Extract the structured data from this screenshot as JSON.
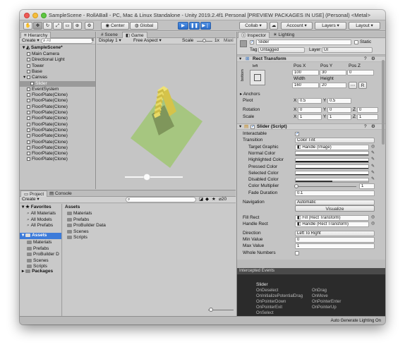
{
  "window": {
    "title": "SampleScene - RollABall - PC, Mac & Linux Standalone - Unity 2019.2.4f1 Personal [PREVIEW PACKAGES IN USE] (Personal) <Metal>"
  },
  "toolbar": {
    "pivot": "Center",
    "space": "Global",
    "collab": "Collab",
    "account": "Account",
    "layers": "Layers",
    "layout": "Layout"
  },
  "hierarchy": {
    "tab": "Hierarchy",
    "create": "Create",
    "search_placeholder": "All",
    "scene": "SampleScene*",
    "items": [
      {
        "label": "Main Camera",
        "indent": 2
      },
      {
        "label": "Directional Light",
        "indent": 2
      },
      {
        "label": "Tower",
        "indent": 2
      },
      {
        "label": "Base",
        "indent": 2
      },
      {
        "label": "Canvas",
        "indent": 2
      },
      {
        "label": "Slider",
        "indent": 3
      },
      {
        "label": "EventSystem",
        "indent": 2
      },
      {
        "label": "FloorPlate(Clone)",
        "indent": 2
      },
      {
        "label": "FloorPlate(Clone)",
        "indent": 2
      },
      {
        "label": "FloorPlate(Clone)",
        "indent": 2
      },
      {
        "label": "FloorPlate(Clone)",
        "indent": 2
      },
      {
        "label": "FloorPlate(Clone)",
        "indent": 2
      },
      {
        "label": "FloorPlate(Clone)",
        "indent": 2
      },
      {
        "label": "FloorPlate(Clone)",
        "indent": 2
      },
      {
        "label": "FloorPlate(Clone)",
        "indent": 2
      },
      {
        "label": "FloorPlate(Clone)",
        "indent": 2
      },
      {
        "label": "FloorPlate(Clone)",
        "indent": 2
      },
      {
        "label": "FloorPlate(Clone)",
        "indent": 2
      },
      {
        "label": "FloorPlate(Clone)",
        "indent": 2
      }
    ]
  },
  "scene_view": {
    "tabs": [
      "Scene",
      "Game"
    ],
    "display": "Display 1",
    "aspect": "Free Aspect",
    "scale_label": "Scale",
    "scale_value": "1x",
    "maximize": "Maxi",
    "slider_value": 0.5
  },
  "project": {
    "tabs": [
      "Project",
      "Console"
    ],
    "create": "Create",
    "count": "20",
    "favorites_label": "Favorites",
    "favorites": [
      "All Materials",
      "All Models",
      "All Prefabs"
    ],
    "assets_label": "Assets",
    "asset_folders": [
      "Materials",
      "Prefabs",
      "ProBuilder D",
      "Scenes",
      "Scripts"
    ],
    "packages_label": "Packages",
    "main_header": "Assets",
    "main_items": [
      "Materials",
      "Prefabs",
      "ProBuilder Data",
      "Scenes",
      "Scripts"
    ]
  },
  "inspector": {
    "tabs": [
      "Inspector",
      "Lighting"
    ],
    "object_name": "Slider",
    "static_label": "Static",
    "tag_label": "Tag",
    "tag_value": "Untagged",
    "layer_label": "Layer",
    "layer_value": "UI",
    "rect_transform": {
      "title": "Rect Transform",
      "anchor_h": "left",
      "anchor_v": "bottom",
      "pos_x_label": "Pos X",
      "pos_y_label": "Pos Y",
      "pos_z_label": "Pos Z",
      "pos_x": "100",
      "pos_y": "30",
      "pos_z": "0",
      "width_label": "Width",
      "height_label": "Height",
      "width": "160",
      "height": "20",
      "anchors_label": "Anchors",
      "pivot_label": "Pivot",
      "pivot_x": "0.5",
      "pivot_y": "0.5",
      "rotation_label": "Rotation",
      "rot_x": "0",
      "rot_y": "0",
      "rot_z": "0",
      "scale_label": "Scale",
      "scale_x": "1",
      "scale_y": "1",
      "scale_z": "1",
      "x": "X",
      "y": "Y",
      "z": "Z",
      "r_btn": "R"
    },
    "slider": {
      "title": "Slider (Script)",
      "interactable_label": "Interactable",
      "transition_label": "Transition",
      "transition_value": "Color Tint",
      "target_graphic_label": "Target Graphic",
      "target_graphic_value": "Handle (Image)",
      "normal_color_label": "Normal Color",
      "highlighted_color_label": "Highlighted Color",
      "pressed_color_label": "Pressed Color",
      "selected_color_label": "Selected Color",
      "disabled_color_label": "Disabled Color",
      "color_multiplier_label": "Color Multiplier",
      "color_multiplier_value": "1",
      "fade_duration_label": "Fade Duration",
      "fade_duration_value": "0.1",
      "navigation_label": "Navigation",
      "navigation_value": "Automatic",
      "visualize_label": "Visualize",
      "fill_rect_label": "Fill Rect",
      "fill_rect_value": "Fill (Rect Transform)",
      "handle_rect_label": "Handle Rect",
      "handle_rect_value": "Handle (Rect Transform)",
      "direction_label": "Direction",
      "direction_value": "Left To Right",
      "min_value_label": "Min Value",
      "min_value": "0",
      "max_value_label": "Max Value",
      "max_value": "1",
      "whole_numbers_label": "Whole Numbers"
    },
    "intercepted": {
      "title": "Intercepted Events",
      "object": "Slider",
      "events_left": [
        "OnDeselect",
        "OnInitializePotentialDrag",
        "OnPointerDown",
        "OnPointerExit",
        "OnSelect"
      ],
      "events_right": [
        "OnDrag",
        "OnMove",
        "OnPointerEnter",
        "OnPointerUp"
      ]
    }
  },
  "status": {
    "right": "Auto Generate Lighting On"
  },
  "colors": {
    "accent": "#3c7fdc",
    "selection": "#3d7bd9",
    "plane": "#a6c680",
    "tower": "#dccd55",
    "sky": "#c5c5c5"
  }
}
